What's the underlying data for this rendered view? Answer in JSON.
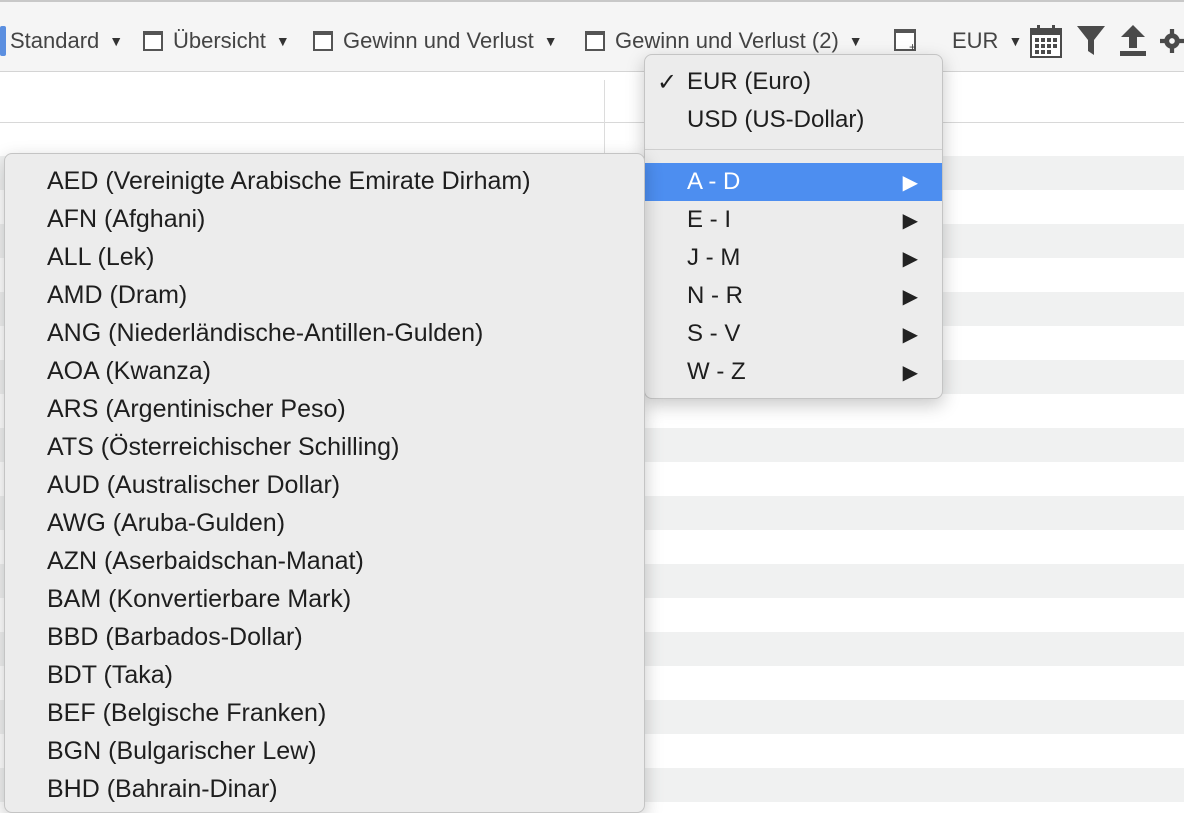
{
  "toolbar": {
    "views": [
      {
        "label": "Standard"
      },
      {
        "label": "Übersicht"
      },
      {
        "label": "Gewinn und Verlust"
      },
      {
        "label": "Gewinn und Verlust (2)"
      }
    ],
    "currency_label": "EUR",
    "icons": [
      "new-view-icon",
      "calendar-icon",
      "filter-icon",
      "export-icon",
      "settings-icon"
    ]
  },
  "currency_menu": {
    "items": [
      {
        "label": "EUR (Euro)",
        "checked": true
      },
      {
        "label": "USD (US-Dollar)",
        "checked": false
      }
    ],
    "check_mark": "✓",
    "groups": [
      {
        "label": "A - D",
        "highlighted": true
      },
      {
        "label": "E - I",
        "highlighted": false
      },
      {
        "label": "J - M",
        "highlighted": false
      },
      {
        "label": "N - R",
        "highlighted": false
      },
      {
        "label": "S - V",
        "highlighted": false
      },
      {
        "label": "W - Z",
        "highlighted": false
      }
    ],
    "submenu_arrow": "▶"
  },
  "submenu_a_d": [
    "AED (Vereinigte Arabische Emirate Dirham)",
    "AFN (Afghani)",
    "ALL (Lek)",
    "AMD (Dram)",
    "ANG (Niederländische-Antillen-Gulden)",
    "AOA (Kwanza)",
    "ARS (Argentinischer Peso)",
    "ATS (Österreichischer Schilling)",
    "AUD (Australischer Dollar)",
    "AWG (Aruba-Gulden)",
    "AZN (Aserbaidschan-Manat)",
    "BAM (Konvertierbare Mark)",
    "BBD (Barbados-Dollar)",
    "BDT (Taka)",
    "BEF (Belgische Franken)",
    "BGN (Bulgarischer Lew)",
    "BHD (Bahrain-Dinar)"
  ],
  "colors": {
    "highlight": "#4d8ef0",
    "menu_bg": "#ececec",
    "stripe": "#f0f1f1"
  }
}
